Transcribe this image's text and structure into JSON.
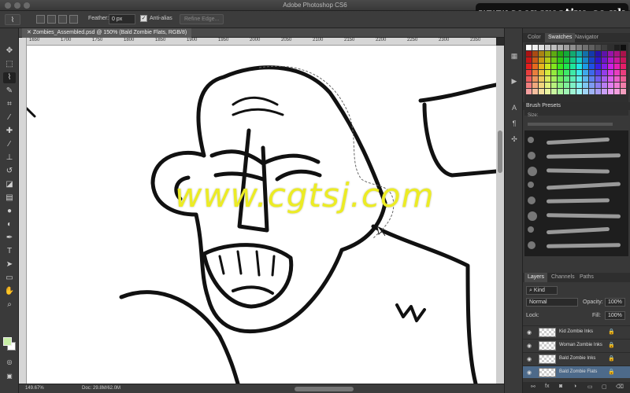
{
  "window": {
    "title": "Adobe Photoshop CS6"
  },
  "watermark_badge": "www.seencreative.co.uk",
  "options_bar": {
    "tool_icon": "lasso-icon",
    "feather_label": "Feather:",
    "feather_value": "0 px",
    "antialias_label": "Anti-alias",
    "antialias_checked": true,
    "refine_edge_label": "Refine Edge..."
  },
  "document": {
    "tab_title": "Zombies_Assembled.psd @ 150% (Bald Zombie Flats, RGB/8)",
    "ruler_ticks": [
      "1650",
      "1700",
      "1750",
      "1800",
      "1850",
      "1900",
      "1950",
      "2000",
      "2050",
      "2100",
      "2150",
      "2200",
      "2250",
      "2300",
      "2350"
    ],
    "watermark_text": "www.cgtsj.com",
    "zoom": "149.67%",
    "doc_size": "Doc: 29.8M/62.0M"
  },
  "tools": [
    {
      "name": "move-icon",
      "glyph": "✥"
    },
    {
      "name": "marquee-icon",
      "glyph": "⬚"
    },
    {
      "name": "lasso-icon",
      "glyph": "⌇"
    },
    {
      "name": "quick-select-icon",
      "glyph": "✎"
    },
    {
      "name": "crop-icon",
      "glyph": "⌗"
    },
    {
      "name": "eyedropper-icon",
      "glyph": "⁄"
    },
    {
      "name": "healing-icon",
      "glyph": "✚"
    },
    {
      "name": "brush-icon",
      "glyph": "∕"
    },
    {
      "name": "stamp-icon",
      "glyph": "⊥"
    },
    {
      "name": "history-brush-icon",
      "glyph": "↺"
    },
    {
      "name": "eraser-icon",
      "glyph": "◪"
    },
    {
      "name": "gradient-icon",
      "glyph": "▤"
    },
    {
      "name": "blur-icon",
      "glyph": "●"
    },
    {
      "name": "dodge-icon",
      "glyph": "◐"
    },
    {
      "name": "pen-icon",
      "glyph": "✒"
    },
    {
      "name": "type-icon",
      "glyph": "T"
    },
    {
      "name": "path-select-icon",
      "glyph": "➤"
    },
    {
      "name": "shape-icon",
      "glyph": "▭"
    },
    {
      "name": "hand-icon",
      "glyph": "✋"
    },
    {
      "name": "zoom-icon",
      "glyph": "⌕"
    }
  ],
  "strip_icons": [
    {
      "name": "history-panel-icon",
      "glyph": "▦"
    },
    {
      "name": "actions-panel-icon",
      "glyph": "▶"
    },
    {
      "name": "character-panel-icon",
      "glyph": "A"
    },
    {
      "name": "paragraph-panel-icon",
      "glyph": "¶"
    },
    {
      "name": "brush-panel-icon",
      "glyph": "✣"
    }
  ],
  "panels": {
    "color_tabs": [
      "Color",
      "Swatches",
      "Navigator"
    ],
    "brush_presets": {
      "title": "Brush Presets",
      "size_label": "Size:"
    },
    "layer_tabs": [
      "Layers",
      "Channels",
      "Paths"
    ],
    "filter_kind": "Kind",
    "blend_mode": "Normal",
    "opacity_label": "Opacity:",
    "opacity_value": "100%",
    "lock_label": "Lock:",
    "fill_label": "Fill:",
    "fill_value": "100%",
    "layers": [
      {
        "name": "Kid Zombie Inks",
        "selected": false
      },
      {
        "name": "Woman Zombie Inks",
        "selected": false
      },
      {
        "name": "Bald Zombie Inks",
        "selected": false
      },
      {
        "name": "Bald Zombie Flats",
        "selected": true
      }
    ]
  }
}
